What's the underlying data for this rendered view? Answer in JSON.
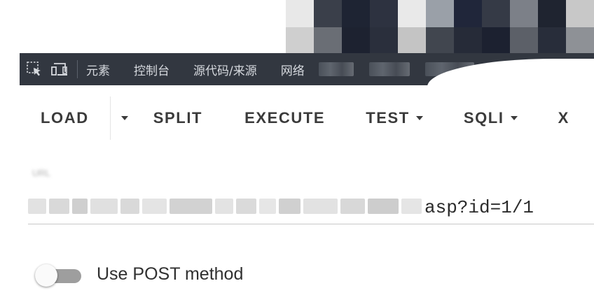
{
  "devtools": {
    "tabs": [
      "元素",
      "控制台",
      "源代码/来源",
      "网络"
    ],
    "icons": [
      "select-element-icon",
      "device-toggle-icon"
    ],
    "bar_color": "#323740"
  },
  "toolbar": {
    "load_label": "LOAD",
    "split_label": "SPLIT",
    "execute_label": "EXECUTE",
    "test_label": "TEST",
    "sqli_label": "SQLI",
    "x_label": "X"
  },
  "url_field": {
    "value_visible": "asp?id=1/1"
  },
  "post_toggle": {
    "label": "Use POST method",
    "enabled": false
  }
}
